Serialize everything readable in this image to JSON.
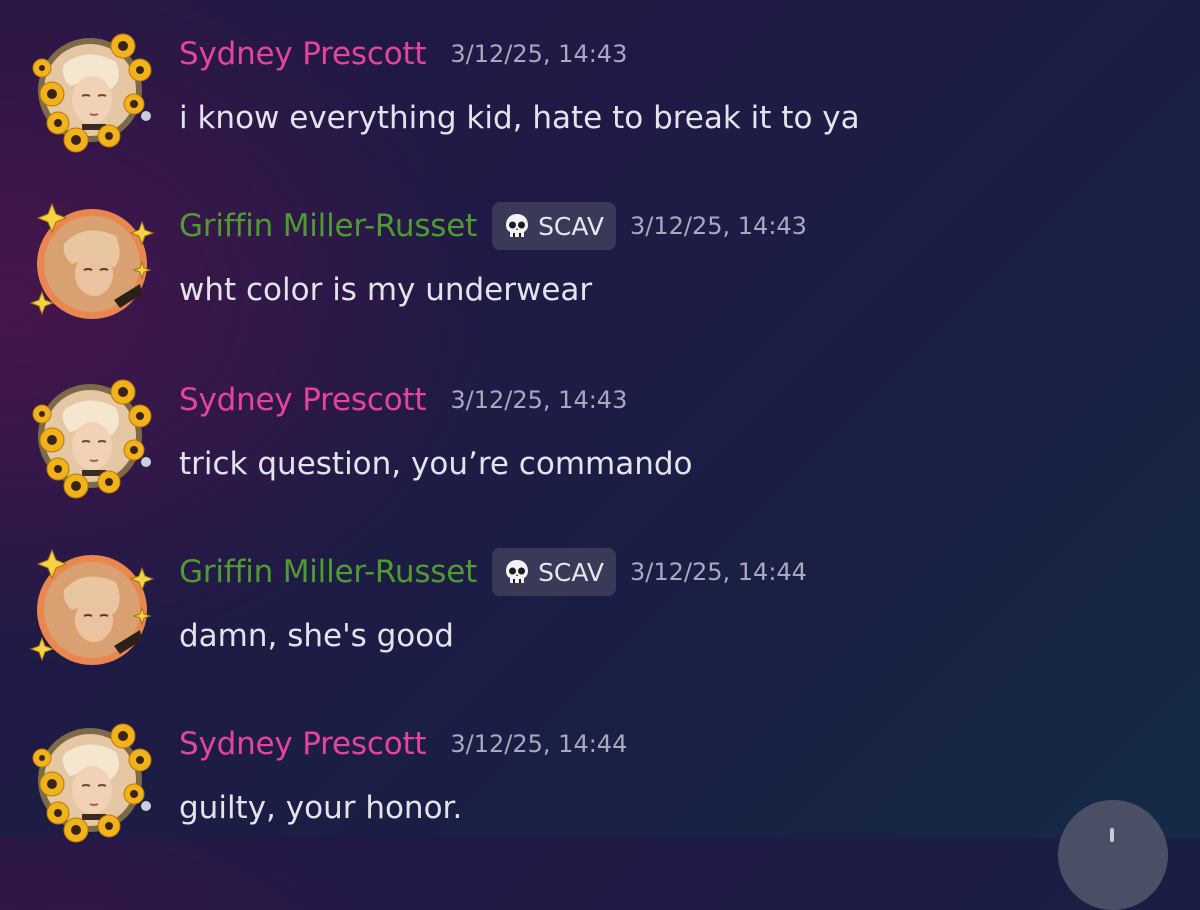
{
  "messages": [
    {
      "author": "Sydney Prescott",
      "timestamp": "3/12/25, 14:43",
      "content": "i know everything kid, hate to break it to ya"
    },
    {
      "author": "Griffin Miller-Russet",
      "tag": "SCAV",
      "tag_icon": "skull-icon",
      "timestamp": "3/12/25, 14:43",
      "content": "wht color is my underwear"
    },
    {
      "author": "Sydney Prescott",
      "timestamp": "3/12/25, 14:43",
      "content": "trick question, you’re commando"
    },
    {
      "author": "Griffin Miller-Russet",
      "tag": "SCAV",
      "tag_icon": "skull-icon",
      "timestamp": "3/12/25, 14:44",
      "content": "damn, she's good"
    },
    {
      "author": "Sydney Prescott",
      "timestamp": "3/12/25, 14:44",
      "content": "guilty, your honor."
    }
  ],
  "colors": {
    "sydney_name": "#e4449f",
    "griffin_name": "#4f9b2f",
    "message_text": "#e3e3ec",
    "timestamp_text": "#a8a8be",
    "tag_background": "#3a3a58"
  },
  "icons": {
    "sydney_avatar": "sunflower-avatar-icon",
    "griffin_avatar": "sparkle-avatar-icon",
    "scroll_button": "arrow-down-icon"
  }
}
